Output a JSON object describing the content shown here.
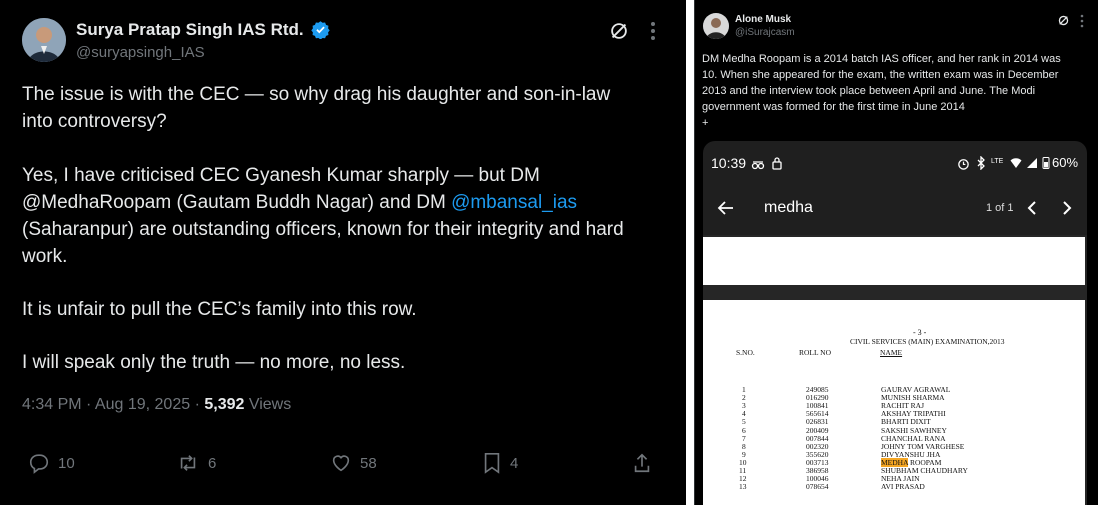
{
  "left_tweet": {
    "author_name": "Surya Pratap Singh IAS Rtd.",
    "author_handle": "@suryapsingh_IAS",
    "paragraphs": [
      [
        "The issue is with the CEC — so why drag his daughter and son-in-law",
        "into controversy?"
      ],
      [
        "Yes, I have criticised CEC Gyanesh Kumar sharply — but DM"
      ],
      [
        "(Saharanpur) are outstanding officers, known for their integrity and hard",
        "work."
      ],
      [
        "It is unfair to pull the CEC’s family into this row."
      ],
      [
        "I will speak only the truth — no more, no less."
      ]
    ],
    "mention1": "@MedhaRoopam",
    "mention1_after": " (Gautam Buddh Nagar) and DM ",
    "mention2": "@mbansal_ias",
    "time": "4:34 PM · Aug 19, 2025 · ",
    "views_count": "5,392",
    "views_label": " Views",
    "replies": "10",
    "reposts": "6",
    "likes": "58",
    "bookmarks": "4",
    "colors": {
      "link": "#1d9bf0",
      "verified": "#1d9bf0",
      "muted": "#71767b"
    }
  },
  "right_tweet": {
    "author_name": "Alone Musk",
    "author_handle": "@iSurajcasm",
    "text_lines": [
      "DM Medha Roopam is a 2014 batch IAS officer, and her rank in 2014 was",
      "10. When she appeared for the exam, the written exam was in December",
      "2013 and the interview took place between April and June. The Modi",
      "government was formed for the first time in June 2014",
      "+"
    ]
  },
  "phone": {
    "status_time": "10:39",
    "battery": "60%",
    "network": "LTE",
    "search_query": "medha",
    "match_count": "1 of 1",
    "doc": {
      "page_number": "- 3 -",
      "heading": "CIVIL SERVICES (MAIN) EXAMINATION,2013",
      "col_sno": "S.NO.",
      "col_roll": "ROLL NO",
      "col_name": "NAME",
      "rows": [
        {
          "sno": "1",
          "roll": "249085",
          "name": "GAURAV AGRAWAL"
        },
        {
          "sno": "2",
          "roll": "016290",
          "name": "MUNISH SHARMA"
        },
        {
          "sno": "3",
          "roll": "100841",
          "name": "RACHIT RAJ"
        },
        {
          "sno": "4",
          "roll": "565614",
          "name": "AKSHAY TRIPATHI"
        },
        {
          "sno": "5",
          "roll": "026831",
          "name": "BHARTI DIXIT"
        },
        {
          "sno": "6",
          "roll": "200409",
          "name": "SAKSHI SAWHNEY"
        },
        {
          "sno": "7",
          "roll": "007844",
          "name": "CHANCHAL RANA"
        },
        {
          "sno": "8",
          "roll": "002320",
          "name": "JOHNY TOM VARGHESE"
        },
        {
          "sno": "9",
          "roll": "355620",
          "name": "DIVYANSHU JHA"
        },
        {
          "sno": "10",
          "roll": "003713",
          "name_highlight": "MEDHA",
          "name": " ROOPAM"
        },
        {
          "sno": "11",
          "roll": "386958",
          "name": "SHUBHAM CHAUDHARY"
        },
        {
          "sno": "12",
          "roll": "100046",
          "name": "NEHA JAIN"
        },
        {
          "sno": "13",
          "roll": "078654",
          "name": "AVI PRASAD"
        }
      ]
    }
  }
}
